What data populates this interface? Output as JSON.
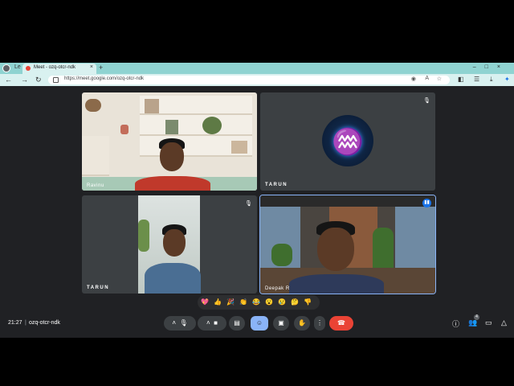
{
  "browser": {
    "tab_title": "Meet - ozq-otcr-ndk",
    "tab_prev_label": "Le",
    "url": "https://meet.google.com/ozq-otcr-ndk"
  },
  "tiles": [
    {
      "name": "Ravinu",
      "muted": false
    },
    {
      "name": "TARUN",
      "muted": true
    },
    {
      "name": "TARUN",
      "muted": true
    },
    {
      "name": "Deepak R",
      "muted": false
    }
  ],
  "reactions": [
    "💖",
    "👍",
    "🎉",
    "👏",
    "😂",
    "😮",
    "😢",
    "🤔",
    "👎"
  ],
  "meeting": {
    "time": "21:27",
    "divider": "|",
    "code": "ozq-otcr-ndk",
    "participant_count": "4"
  },
  "icons": {
    "mic": "microphone-icon",
    "camera": "camera-icon",
    "captions": "captions-icon",
    "emoji": "emoji-icon",
    "present": "present-icon",
    "hand": "raise-hand-icon",
    "more": "more-icon",
    "end": "end-call-icon",
    "info": "info-icon",
    "people": "people-icon",
    "chat": "chat-icon",
    "activities": "activities-icon"
  },
  "colors": {
    "end_call": "#ea4335",
    "active": "#8ab4f8",
    "background": "#202124",
    "tile": "#3c4043"
  }
}
